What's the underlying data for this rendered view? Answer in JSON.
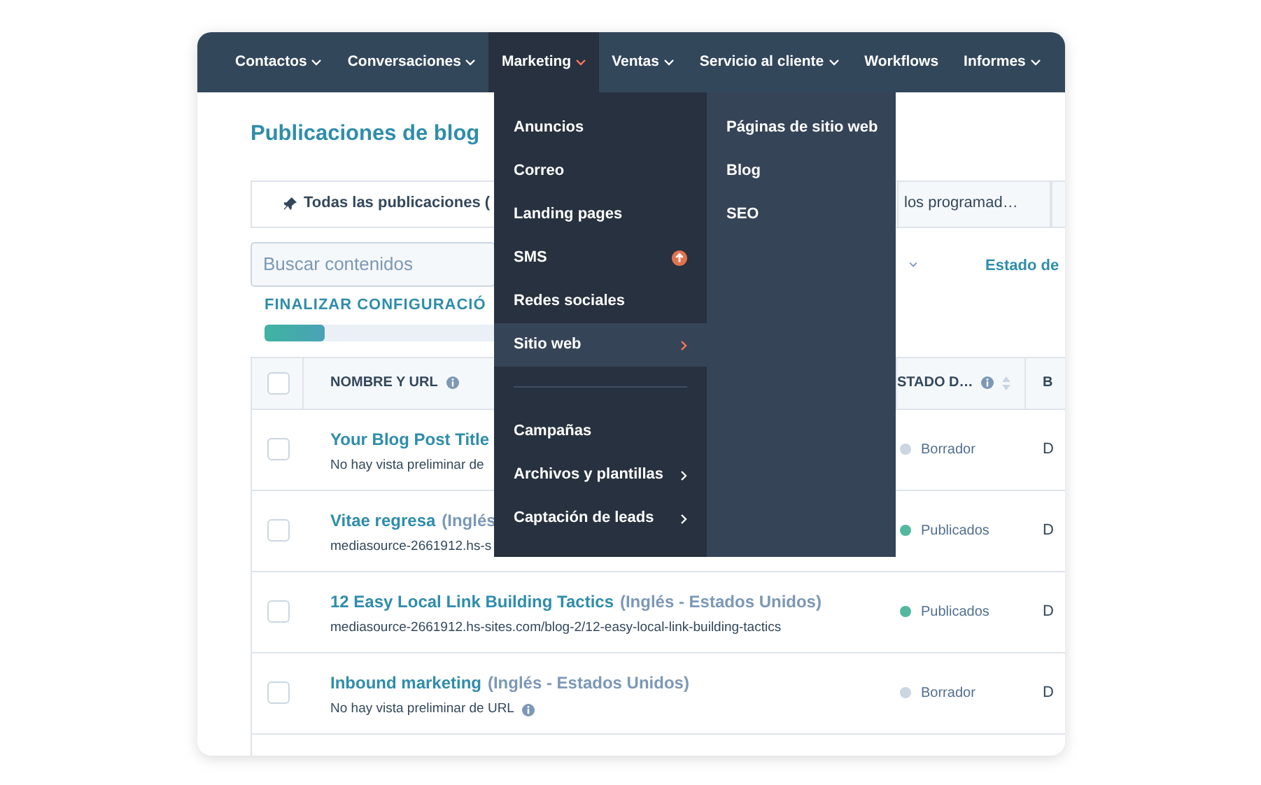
{
  "nav": [
    {
      "label": "Contactos",
      "caret": true,
      "selected": false
    },
    {
      "label": "Conversaciones",
      "caret": true,
      "selected": false
    },
    {
      "label": "Marketing",
      "caret": true,
      "selected": true
    },
    {
      "label": "Ventas",
      "caret": true,
      "selected": false
    },
    {
      "label": "Servicio al cliente",
      "caret": true,
      "selected": false
    },
    {
      "label": "Workflows",
      "caret": false,
      "selected": false
    },
    {
      "label": "Informes",
      "caret": true,
      "selected": false
    }
  ],
  "page_title": "Publicaciones de blog",
  "tabs": [
    {
      "label": "Todas las publicaciones (",
      "pinned": true,
      "selected": true
    },
    {
      "label": "los programad…",
      "pinned": false,
      "selected": false
    },
    {
      "pinned": false,
      "selected": false
    }
  ],
  "search": {
    "placeholder": "Buscar contenidos"
  },
  "filter": {
    "label": "Estado de"
  },
  "setup": {
    "label": "FINALIZAR CONFIGURACIÓ",
    "level": 0.16
  },
  "table": {
    "select_all": {
      "checked": false
    },
    "columns": [
      {
        "label": "NOMBRE Y URL",
        "info": true
      },
      {
        "label": "STADO D…",
        "info": true
      },
      {
        "label": "B",
        "info": false
      }
    ],
    "rows": [
      {
        "checked": false,
        "title": "Your Blog Post Title",
        "lang": "",
        "sub": "No hay vista preliminar de",
        "sub_info": false,
        "status": "Borrador",
        "color": "#cbd6e2",
        "column_3": "D"
      },
      {
        "checked": false,
        "title": "Vitae regresa",
        "lang": "(Inglés",
        "sub": "mediasource-2661912.hs-s",
        "sub_info": false,
        "status": "Publicados",
        "color": "#52b9a0",
        "column_3": "D"
      },
      {
        "checked": false,
        "title": "12 Easy Local Link Building Tactics",
        "lang": "(Inglés - Estados Unidos)",
        "sub": "mediasource-2661912.hs-sites.com/blog-2/12-easy-local-link-building-tactics",
        "sub_info": false,
        "status": "Publicados",
        "color": "#52b9a0",
        "column_3": "D"
      },
      {
        "checked": false,
        "title": "Inbound marketing",
        "lang": "(Inglés - Estados Unidos)",
        "sub": "No hay vista preliminar de URL",
        "sub_info": true,
        "status": "Borrador",
        "color": "#cbd6e2",
        "column_3": "D"
      }
    ]
  },
  "menu": [
    {
      "kind": "item",
      "label": "Anuncios",
      "selected": false,
      "submenu": false,
      "badge": false
    },
    {
      "kind": "item",
      "label": "Correo",
      "selected": false,
      "submenu": false,
      "badge": false
    },
    {
      "kind": "item",
      "label": "Landing pages",
      "selected": false,
      "submenu": false,
      "badge": false
    },
    {
      "kind": "item",
      "label": "SMS",
      "selected": false,
      "submenu": false,
      "badge": true
    },
    {
      "kind": "item",
      "label": "Redes sociales",
      "selected": false,
      "submenu": false,
      "badge": false
    },
    {
      "kind": "item",
      "label": "Sitio web",
      "selected": true,
      "submenu": true,
      "badge": false
    },
    {
      "kind": "divider"
    },
    {
      "kind": "item",
      "label": "Campañas",
      "selected": false,
      "submenu": false,
      "badge": false
    },
    {
      "kind": "item",
      "label": "Archivos y plantillas",
      "selected": false,
      "submenu": true,
      "badge": false
    },
    {
      "kind": "item",
      "label": "Captación de leads",
      "selected": false,
      "submenu": true,
      "badge": false
    }
  ],
  "submenu": [
    "Páginas de sitio web",
    "Blog",
    "SEO"
  ]
}
